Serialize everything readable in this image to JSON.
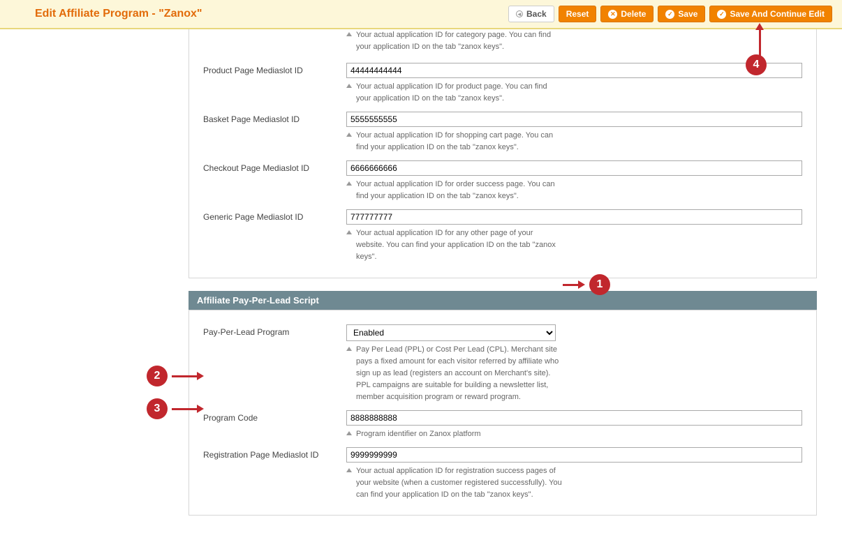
{
  "header": {
    "title": "Edit Affiliate Program - \"Zanox\"",
    "buttons": {
      "back": "Back",
      "reset": "Reset",
      "delete": "Delete",
      "save": "Save",
      "save_continue": "Save And Continue Edit"
    }
  },
  "section1": {
    "prev_hint_top": "Your actual application ID for category page. You can find your application ID on the tab \"zanox keys\".",
    "fields": [
      {
        "label": "Product Page Mediaslot ID",
        "value": "44444444444",
        "hint": "Your actual application ID for product page. You can find your application ID on the tab \"zanox keys\"."
      },
      {
        "label": "Basket Page Mediaslot ID",
        "value": "5555555555",
        "hint": "Your actual application ID for shopping cart page. You can find your application ID on the tab \"zanox keys\"."
      },
      {
        "label": "Checkout Page Mediaslot ID",
        "value": "6666666666",
        "hint": "Your actual application ID for order success page. You can find your application ID on the tab \"zanox keys\"."
      },
      {
        "label": "Generic Page Mediaslot ID",
        "value": "777777777",
        "hint": "Your actual application ID for any other page of your website. You can find your application ID on the tab \"zanox keys\"."
      }
    ]
  },
  "section2": {
    "title": "Affiliate Pay-Per-Lead Script",
    "field_select": {
      "label": "Pay-Per-Lead Program",
      "value": "Enabled",
      "hint": "Pay Per Lead (PPL) or Cost Per Lead (CPL). Merchant site pays a fixed amount for each visitor referred by affiliate who sign up as lead (registers an account on Merchant's site). PPL campaigns are suitable for building a newsletter list, member acquisition program or reward program."
    },
    "fields": [
      {
        "label": "Program Code",
        "value": "8888888888",
        "hint": "Program identifier on Zanox platform"
      },
      {
        "label": "Registration Page Mediaslot ID",
        "value": "9999999999",
        "hint": "Your actual application ID for registration success pages of your website (when a customer registered successfully). You can find your application ID on the tab \"zanox keys\"."
      }
    ]
  },
  "annotations": {
    "b1": "1",
    "b2": "2",
    "b3": "3",
    "b4": "4"
  }
}
